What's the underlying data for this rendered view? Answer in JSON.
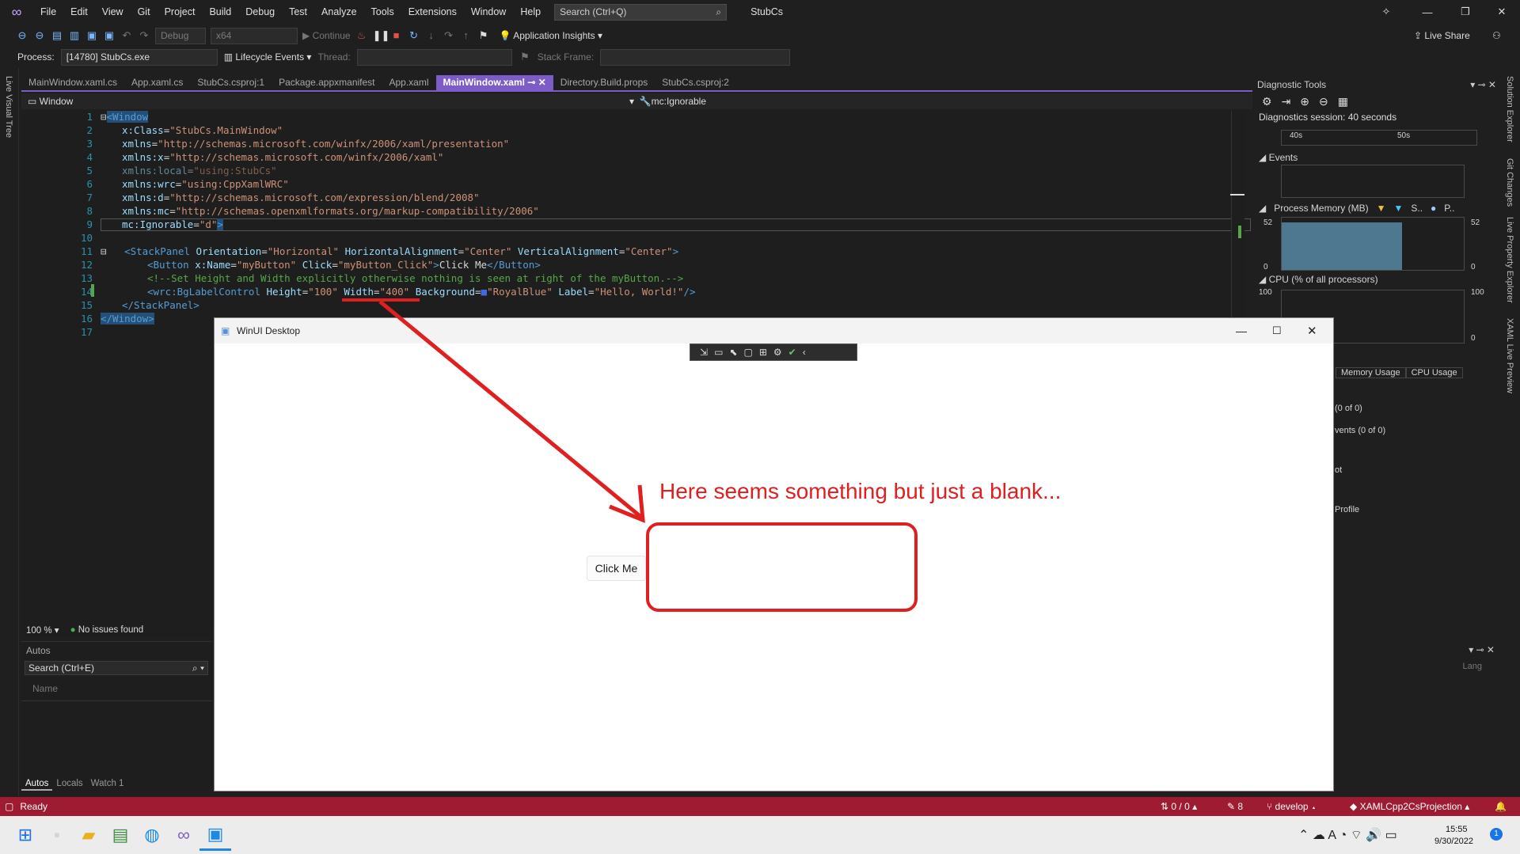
{
  "menubar": {
    "items": [
      "File",
      "Edit",
      "View",
      "Git",
      "Project",
      "Build",
      "Debug",
      "Test",
      "Analyze",
      "Tools",
      "Extensions",
      "Window",
      "Help"
    ],
    "search_placeholder": "Search (Ctrl+Q)",
    "solution": "StubCs"
  },
  "toolbar1": {
    "config": "Debug",
    "platform": "x64",
    "continue": "Continue",
    "app_insights": "Application Insights",
    "live_share": "Live Share"
  },
  "toolbar2": {
    "process_label": "Process:",
    "process_value": "[14780] StubCs.exe",
    "lifecycle": "Lifecycle Events",
    "thread_label": "Thread:",
    "stack_frame_label": "Stack Frame:"
  },
  "left_strip": {
    "label": "Live Visual Tree"
  },
  "tabs": [
    "MainWindow.xaml.cs",
    "App.xaml.cs",
    "StubCs.csproj:1",
    "Package.appxmanifest",
    "App.xaml",
    "MainWindow.xaml",
    "Directory.Build.props",
    "StubCs.csproj:2"
  ],
  "navbar": {
    "left": "Window",
    "right": "mc:Ignorable"
  },
  "editor": {
    "line_numbers": [
      "1",
      "2",
      "3",
      "4",
      "5",
      "6",
      "7",
      "8",
      "9",
      "10",
      "11",
      "12",
      "13",
      "14",
      "15",
      "16",
      "17"
    ]
  },
  "zoom_bar": {
    "zoom": "100 %",
    "issues": "No issues found"
  },
  "autos": {
    "title": "Autos",
    "search": "Search (Ctrl+E)",
    "col_name": "Name",
    "tabs": [
      "Autos",
      "Locals",
      "Watch 1"
    ]
  },
  "diagnostics": {
    "title": "Diagnostic Tools",
    "session": "Diagnostics session: 40 seconds",
    "t40": "40s",
    "t50": "50s",
    "events": "Events",
    "process_memory": "Process Memory (MB)",
    "mem_legend_s": "S..",
    "mem_legend_p": "P..",
    "mem_max": "52",
    "mem_min": "0",
    "cpu": "CPU (% of all processors)",
    "cpu_max": "100",
    "cpu_min": "0",
    "tab_memory": "Memory Usage",
    "tab_cpu": "CPU Usage",
    "tab_prefix": "s",
    "row1": "(0 of 0)",
    "row2": "vents (0 of 0)",
    "row3": "ot",
    "row4": "Profile",
    "lang": "Lang"
  },
  "right_strip": {
    "labels": [
      "Solution Explorer",
      "Git Changes",
      "Live Property Explorer",
      "XAML Live Preview"
    ]
  },
  "app_window": {
    "title": "WinUI Desktop",
    "button": "Click Me"
  },
  "annotation": {
    "text": "Here seems something but just a blank..."
  },
  "statusbar": {
    "ready": "Ready",
    "changes": "0 / 0",
    "edits": "8",
    "branch": "develop",
    "repo": "XAMLCpp2CsProjection"
  },
  "taskbar": {
    "time": "15:55",
    "date": "9/30/2022",
    "badge": "1"
  },
  "colors": {
    "accent": "#7d5cc8",
    "status": "#9e1b32",
    "annotation": "#e02020"
  }
}
